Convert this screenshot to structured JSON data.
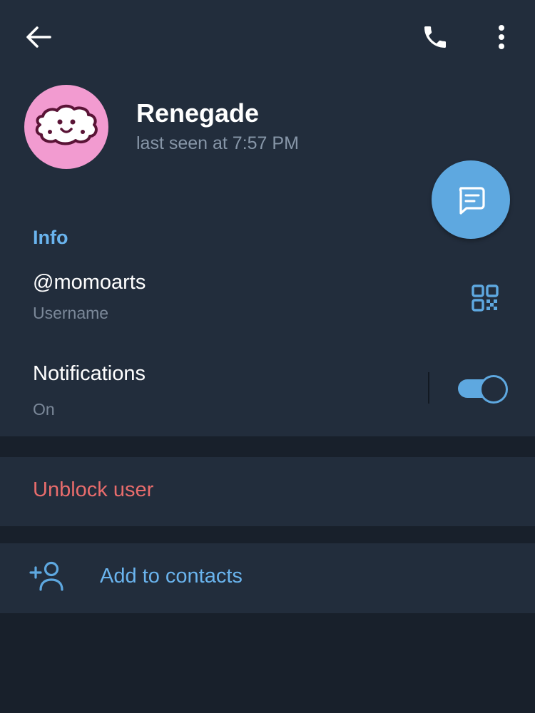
{
  "header": {
    "back_icon": "arrow-left-icon",
    "call_icon": "phone-icon",
    "menu_icon": "more-vertical-icon"
  },
  "profile": {
    "name": "Renegade",
    "status": "last seen at 7:57 PM",
    "avatar_bg": "#f29bd0"
  },
  "fab": {
    "icon": "message-icon"
  },
  "info": {
    "section_title": "Info",
    "username": "@momoarts",
    "username_label": "Username",
    "qr_icon": "qr-code-icon",
    "notifications_title": "Notifications",
    "notifications_status": "On",
    "notifications_enabled": true
  },
  "actions": {
    "unblock_label": "Unblock user",
    "add_contact_label": "Add to contacts",
    "add_contact_icon": "add-person-icon"
  },
  "colors": {
    "background": "#18202b",
    "card": "#222d3c",
    "accent": "#5ea8e0",
    "link": "#6ab4ee",
    "danger": "#e86c6c",
    "secondary_text": "#8796a8"
  }
}
